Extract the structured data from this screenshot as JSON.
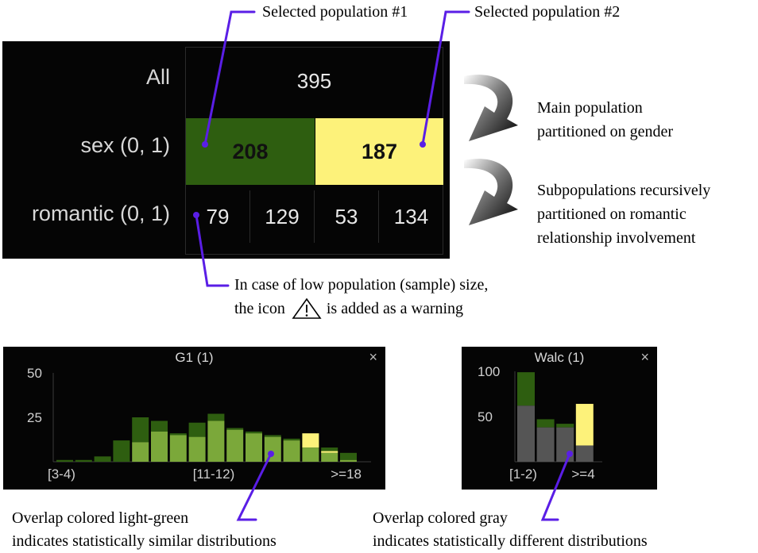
{
  "callouts": {
    "pop1": "Selected population #1",
    "pop2": "Selected population #2",
    "main_line1": "Main population",
    "main_line2": "partitioned on gender",
    "sub_line1": "Subpopulations recursively",
    "sub_line2": "partitioned on romantic",
    "sub_line3": "relationship involvement",
    "warn_line1": "In case of low population (sample) size,",
    "warn_line2_a": "the icon",
    "warn_line2_b": "is added as a warning",
    "green_line1": "Overlap colored light-green",
    "green_line2": "indicates statistically similar distributions",
    "gray_line1": "Overlap colored gray",
    "gray_line2": "indicates statistically different distributions"
  },
  "tree": {
    "rows": [
      {
        "label": "All"
      },
      {
        "label": "sex (0, 1)"
      },
      {
        "label": "romantic (0, 1)"
      }
    ],
    "all": "395",
    "sex": [
      "208",
      "187"
    ],
    "romantic": [
      "79",
      "129",
      "53",
      "134"
    ]
  },
  "colors": {
    "dark_green": "#2e5e10",
    "light_green": "#7ba83a",
    "yellow": "#fdf27a",
    "gray": "#555555",
    "callout_line": "#5a1ee6"
  },
  "icons": {
    "warning": "warning-triangle-icon",
    "close": "close-icon",
    "curved_arrow": "curved-arrow-icon"
  },
  "charts": {
    "g1": {
      "title": "G1 (1)",
      "close": "×"
    },
    "walc": {
      "title": "Walc (1)",
      "close": "×"
    }
  },
  "chart_data": [
    {
      "type": "bar",
      "title": "G1 (1)",
      "y_ticks": [
        "50",
        "25"
      ],
      "ylim": [
        0,
        50
      ],
      "x_tick_labels": [
        "[3-4)",
        "[11-12)",
        ">=18"
      ],
      "bin_count": 16,
      "series": [
        {
          "name": "population #1",
          "values": [
            1,
            1,
            3,
            12,
            25,
            23,
            16,
            22,
            27,
            19,
            17,
            15,
            13,
            12,
            8,
            5
          ]
        },
        {
          "name": "population #2",
          "values": [
            0,
            0,
            0,
            0,
            11,
            17,
            15,
            14,
            23,
            18,
            16,
            14,
            12,
            16,
            6,
            1
          ]
        },
        {
          "name": "overlap",
          "values": [
            0,
            0,
            0,
            0,
            11,
            17,
            15,
            14,
            23,
            18,
            16,
            14,
            12,
            8,
            5,
            1
          ]
        }
      ],
      "overlap_color": "light-green"
    },
    {
      "type": "bar",
      "title": "Walc (1)",
      "y_ticks": [
        "100",
        "50"
      ],
      "ylim": [
        0,
        100
      ],
      "x_tick_labels": [
        "[1-2)",
        ">=4"
      ],
      "bin_count": 4,
      "series": [
        {
          "name": "population #1",
          "values": [
            99,
            47,
            42,
            18
          ]
        },
        {
          "name": "population #2",
          "values": [
            62,
            38,
            38,
            64
          ]
        },
        {
          "name": "overlap",
          "values": [
            62,
            38,
            38,
            18
          ]
        }
      ],
      "overlap_color": "gray"
    }
  ]
}
